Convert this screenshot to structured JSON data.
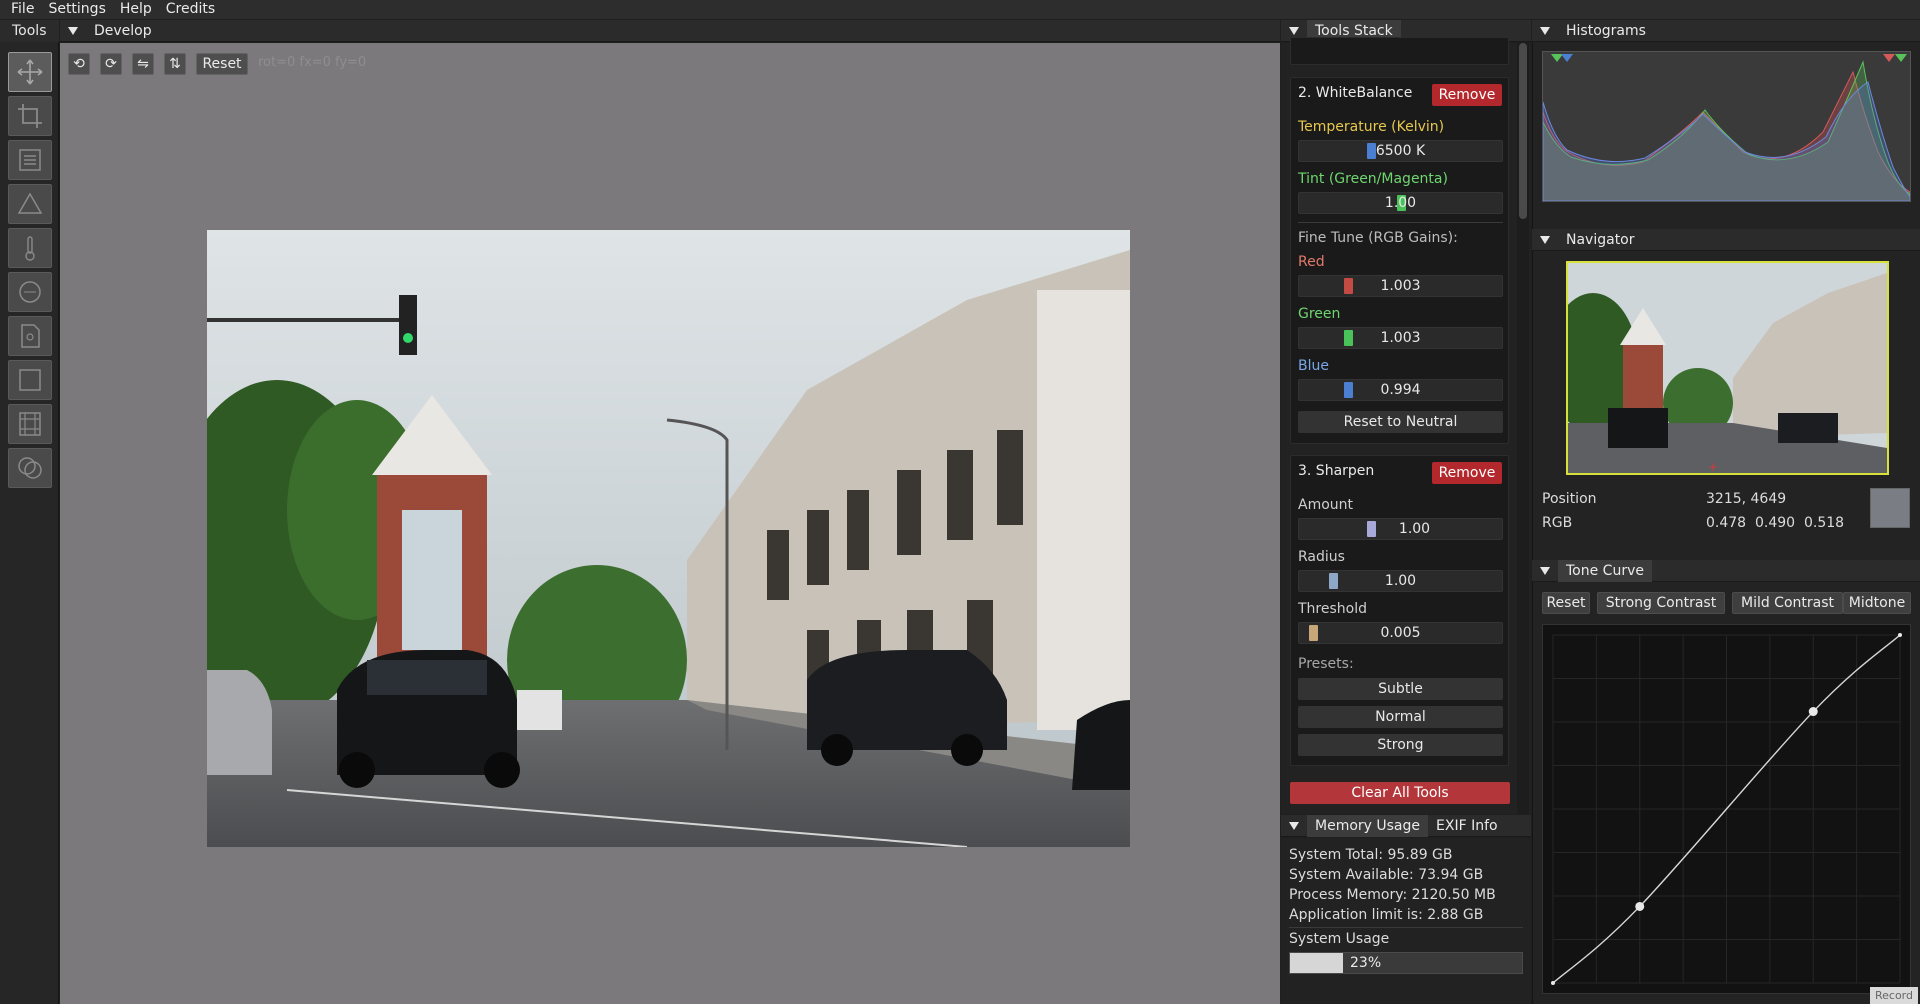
{
  "menu": [
    "File",
    "Settings",
    "Help",
    "Credits"
  ],
  "tools_panel": {
    "title": "Tools",
    "icons": [
      "move-icon",
      "crop-icon",
      "list-icon",
      "triangle-icon",
      "thermometer-icon",
      "circle-icon",
      "document-icon",
      "square-icon",
      "film-icon",
      "overlap-circles-icon"
    ]
  },
  "develop": {
    "title": "Develop",
    "reset_label": "Reset",
    "rotate_ccw": "⟲",
    "rotate_cw": "⟳",
    "flip_h": "⇋",
    "flip_v": "⇅",
    "transform_readout": "rot=0 fx=0 fy=0"
  },
  "tools_stack": {
    "title": "Tools Stack",
    "white_balance": {
      "title": "2. WhiteBalance",
      "remove_label": "Remove",
      "temperature_label": "Temperature (Kelvin)",
      "temperature_value": "6500 K",
      "tint_label": "Tint (Green/Magenta)",
      "tint_value": "1.00",
      "fine_tune_label": "Fine Tune (RGB Gains):",
      "red_label": "Red",
      "red_value": "1.003",
      "green_label": "Green",
      "green_value": "1.003",
      "blue_label": "Blue",
      "blue_value": "0.994",
      "reset_neutral": "Reset to Neutral"
    },
    "sharpen": {
      "title": "3. Sharpen",
      "remove_label": "Remove",
      "amount_label": "Amount",
      "amount_value": "1.00",
      "radius_label": "Radius",
      "radius_value": "1.00",
      "threshold_label": "Threshold",
      "threshold_value": "0.005",
      "presets_label": "Presets:",
      "presets": [
        "Subtle",
        "Normal",
        "Strong"
      ]
    },
    "clear_all": "Clear All Tools"
  },
  "memory": {
    "tab_memory": "Memory Usage",
    "tab_exif": "EXIF Info",
    "system_total": "System Total: 95.89 GB",
    "system_available": "System Available: 73.94 GB",
    "process_memory": "Process Memory: 2120.50 MB",
    "app_limit": "Application limit is: 2.88 GB",
    "system_usage_label": "System Usage",
    "system_usage_text": "23%",
    "system_usage_fraction": 0.23
  },
  "histograms": {
    "title": "Histograms"
  },
  "navigator": {
    "title": "Navigator",
    "position_label": "Position",
    "position_value": "3215, 4649",
    "rgb_label": "RGB",
    "rgb_value": "0.478  0.490  0.518",
    "swatch_color": "#7a7d84"
  },
  "tone_curve": {
    "title": "Tone Curve",
    "buttons": [
      "Reset",
      "Strong Contrast",
      "Mild Contrast",
      "Midtone"
    ],
    "points": [
      [
        0,
        0
      ],
      [
        0.25,
        0.22
      ],
      [
        0.75,
        0.78
      ],
      [
        1,
        1
      ]
    ]
  },
  "record_label": "Record",
  "colors": {
    "accent_red": "#b3282d",
    "temperature_label": "#e6c84f",
    "tint_label": "#6fd66f",
    "red_label": "#e07a6a",
    "green_label": "#6fd66f",
    "blue_label": "#7aa7e8",
    "navigator_border": "#d6e23a"
  }
}
